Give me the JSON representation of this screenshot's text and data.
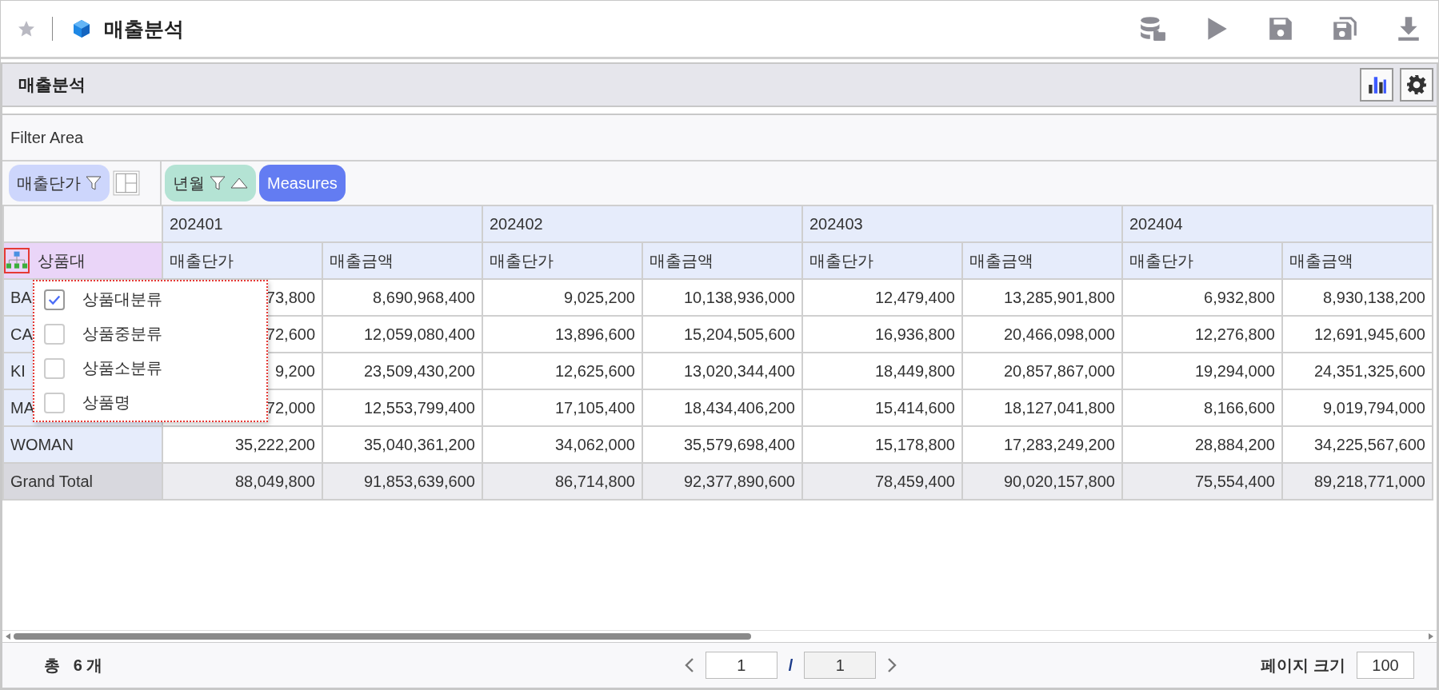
{
  "header": {
    "title": "매출분석"
  },
  "panel": {
    "title": "매출분석"
  },
  "filter_area": {
    "label": "Filter Area"
  },
  "row_field_chips": [
    {
      "label": "매출단가",
      "kind": "measure"
    }
  ],
  "column_field_chips": [
    {
      "label": "년월",
      "kind": "dimension"
    },
    {
      "label": "Measures",
      "kind": "measures"
    }
  ],
  "pivot": {
    "row_header_field": "상품대",
    "periods": [
      "202401",
      "202402",
      "202403",
      "202404"
    ],
    "measure_headers": [
      "매출단가",
      "매출금액",
      "매출단가",
      "매출금액",
      "매출단가",
      "매출금액",
      "매출단가",
      "매출금액"
    ],
    "rows": [
      {
        "label": "BA",
        "cells": [
          "73,800",
          "8,690,968,400",
          "9,025,200",
          "10,138,936,000",
          "12,479,400",
          "13,285,901,800",
          "6,932,800",
          "8,930,138,200"
        ]
      },
      {
        "label": "CA",
        "cells": [
          "72,600",
          "12,059,080,400",
          "13,896,600",
          "15,204,505,600",
          "16,936,800",
          "20,466,098,000",
          "12,276,800",
          "12,691,945,600"
        ]
      },
      {
        "label": "KI",
        "cells": [
          "9,200",
          "23,509,430,200",
          "12,625,600",
          "13,020,344,400",
          "18,449,800",
          "20,857,867,000",
          "19,294,000",
          "24,351,325,600"
        ]
      },
      {
        "label": "MA",
        "cells": [
          "72,000",
          "12,553,799,400",
          "17,105,400",
          "18,434,406,200",
          "15,414,600",
          "18,127,041,800",
          "8,166,600",
          "9,019,794,000"
        ]
      },
      {
        "label": "WOMAN",
        "cells": [
          "35,222,200",
          "35,040,361,200",
          "34,062,000",
          "35,579,698,400",
          "15,178,800",
          "17,283,249,200",
          "28,884,200",
          "34,225,567,600"
        ]
      }
    ],
    "grand_total": {
      "label": "Grand Total",
      "cells": [
        "88,049,800",
        "91,853,639,600",
        "86,714,800",
        "92,377,890,600",
        "78,459,400",
        "90,020,157,800",
        "75,554,400",
        "89,218,771,000"
      ]
    }
  },
  "level_menu": {
    "items": [
      {
        "label": "상품대분류",
        "checked": true
      },
      {
        "label": "상품중분류",
        "checked": false
      },
      {
        "label": "상품소분류",
        "checked": false
      },
      {
        "label": "상품명",
        "checked": false
      }
    ]
  },
  "footer": {
    "total": "총   6 개",
    "page": "1",
    "separator": "/",
    "page_count": "1",
    "page_size_label": "페이지 크기",
    "page_size": "100"
  }
}
